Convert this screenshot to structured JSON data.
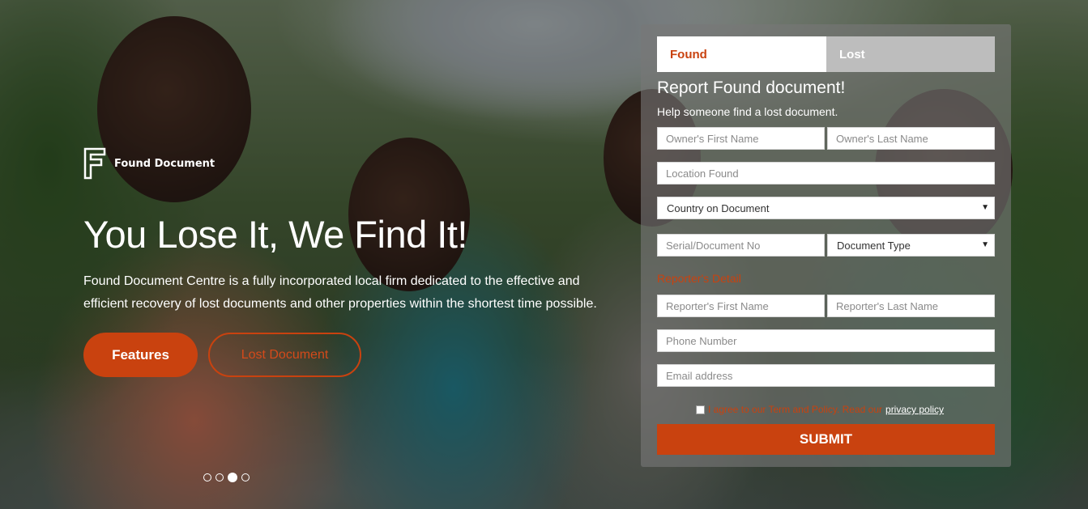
{
  "brand": {
    "name": "Found Document"
  },
  "hero": {
    "title": "You Lose It, We Find It!",
    "description": "Found Document Centre is a fully incorporated local firm dedicated to the effective and efficient recovery of lost documents and other properties within the shortest time possible.",
    "features_label": "Features",
    "lost_document_label": "Lost Document",
    "slide_count": 4,
    "active_slide": 3
  },
  "form": {
    "tabs": [
      {
        "label": "Found",
        "active": true
      },
      {
        "label": "Lost",
        "active": false
      }
    ],
    "title": "Report Found document!",
    "subtitle": "Help someone find a lost document.",
    "owner_first_name_placeholder": "Owner's First Name",
    "owner_last_name_placeholder": "Owner's Last Name",
    "location_found_placeholder": "Location Found",
    "country_select_value": "Country on Document",
    "serial_placeholder": "Serial/Document No",
    "document_type_select_value": "Document Type",
    "reporter_section_label": "Reporter's Detail",
    "reporter_first_name_placeholder": "Reporter's First Name",
    "reporter_last_name_placeholder": "Reporter's Last Name",
    "phone_placeholder": "Phone Number",
    "email_placeholder": "Email address",
    "consent_text": "I agree to our Term and Policy. Read our",
    "privacy_link": "privacy policy",
    "submit_label": "Submit"
  },
  "colors": {
    "accent": "#c9420f",
    "panel": "#787878"
  }
}
